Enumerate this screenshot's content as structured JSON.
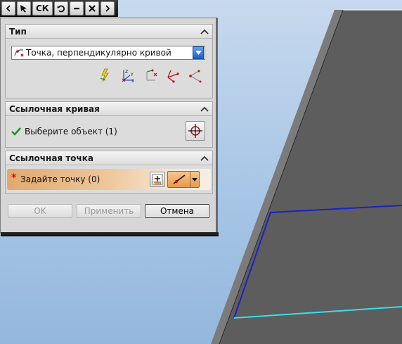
{
  "toolbar": {
    "csys_label": "СК"
  },
  "dialog": {
    "groups": {
      "type": {
        "title": "Тип",
        "selected": "Точка, перпендикулярно кривой"
      },
      "ref_curve": {
        "title": "Ссылочная кривая",
        "prompt": "Выберите объект (1)"
      },
      "ref_point": {
        "title": "Ссылочная точка",
        "prompt": "Задайте точку (0)",
        "required_mark": "*"
      }
    },
    "buttons": {
      "ok": "OK",
      "apply": "Применить",
      "cancel": "Отмена"
    }
  },
  "colors": {
    "model_face": "#5e5e5e",
    "selected_edge": "#1020c8",
    "highlight_edge": "#35e0e8",
    "accent_orange": "#e8a062"
  }
}
